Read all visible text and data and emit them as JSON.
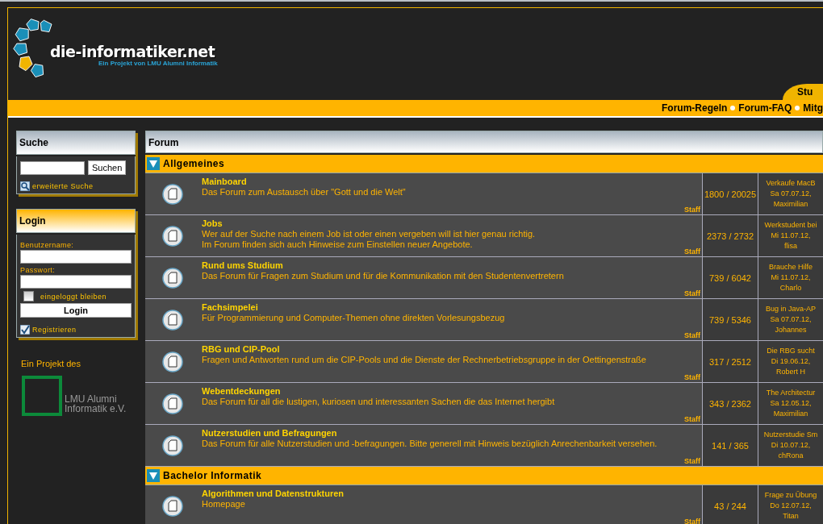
{
  "header": {
    "logo_title": "die-informatiker.net",
    "logo_subtitle": "Ein Projekt von LMU Alumni Informatik",
    "tab": "Stu"
  },
  "nav_links": [
    "Forum-Regeln",
    "Forum-FAQ",
    "Mitg"
  ],
  "search": {
    "title": "Suche",
    "button": "Suchen",
    "advanced_link": "erweiterte Suche"
  },
  "login": {
    "title": "Login",
    "username_label": "Benutzername:",
    "password_label": "Passwort:",
    "remember": {
      "label": "eingeloggt bleiben",
      "checked": false
    },
    "button": "Login",
    "register_link": "Registrieren"
  },
  "sponsor": {
    "caption": "Ein Projekt des",
    "logo_text": [
      "LMU Alumni",
      "Informatik e.V."
    ]
  },
  "forum": {
    "title": "Forum",
    "categories": [
      {
        "name": "Allgemeines",
        "expanded": true,
        "boards": [
          {
            "name": "Mainboard",
            "description": [
              "Das Forum zum Austausch über \"Gott und die Welt\""
            ],
            "moderator": "Staff",
            "counts": "1800 / 20025",
            "last_post": [
              "Verkaufe MacB",
              "Sa 07.07.12,",
              "Maximilian"
            ]
          },
          {
            "name": "Jobs",
            "description": [
              "Wer auf der Suche nach einem Job ist oder einen vergeben will ist hier genau richtig.",
              "Im Forum finden sich auch Hinweise zum Einstellen neuer Angebote."
            ],
            "moderator": "Staff",
            "counts": "2373 / 2732",
            "last_post": [
              "Werkstudent bei",
              "Mi 11.07.12,",
              "flisa"
            ]
          },
          {
            "name": "Rund ums Studium",
            "description": [
              "Das Forum für Fragen zum Studium und für die Kommunikation mit den Studentenvertretern"
            ],
            "moderator": "Staff",
            "counts": "739 / 6042",
            "last_post": [
              "Brauche Hilfe",
              "Mi 11.07.12,",
              "Charlo"
            ]
          },
          {
            "name": "Fachsimpelei",
            "description": [
              "Für Programmierung und Computer-Themen ohne direkten Vorlesungsbezug"
            ],
            "moderator": "Staff",
            "counts": "739 / 5346",
            "last_post": [
              "Bug in Java-AP",
              "Sa 07.07.12,",
              "Johannes"
            ]
          },
          {
            "name": "RBG und CIP-Pool",
            "description": [
              "Fragen und Antworten rund um die CIP-Pools und die Dienste der Rechnerbetriebsgruppe in der Oettingenstraße"
            ],
            "moderator": "Staff",
            "counts": "317 / 2512",
            "last_post": [
              "Die RBG sucht",
              "Di 19.06.12,",
              "Robert H"
            ]
          },
          {
            "name": "Webentdeckungen",
            "description": [
              "Das Forum für all die lustigen, kuriosen und interessanten Sachen die das Internet hergibt"
            ],
            "moderator": "Staff",
            "counts": "343 / 2362",
            "last_post": [
              "The Architectur",
              "Sa 12.05.12,",
              "Maximilian"
            ]
          },
          {
            "name": "Nutzerstudien und Befragungen",
            "description": [
              "Das Forum für alle Nutzerstudien und -befragungen. Bitte generell mit Hinweis bezüglich Anrechenbarkeit versehen."
            ],
            "moderator": "Staff",
            "counts": "141 / 365",
            "last_post": [
              "Nutzerstudie Sm",
              "Di 10.07.12,",
              "chRona"
            ]
          }
        ]
      },
      {
        "name": "Bachelor Informatik",
        "expanded": true,
        "boards": [
          {
            "name": "Algorithmen und Datenstrukturen",
            "description": [
              "Homepage"
            ],
            "moderator": "Staff",
            "counts": "43 / 244",
            "last_post": [
              "Frage zu Übung",
              "Do 12.07.12,",
              "Titan"
            ]
          }
        ]
      }
    ]
  }
}
